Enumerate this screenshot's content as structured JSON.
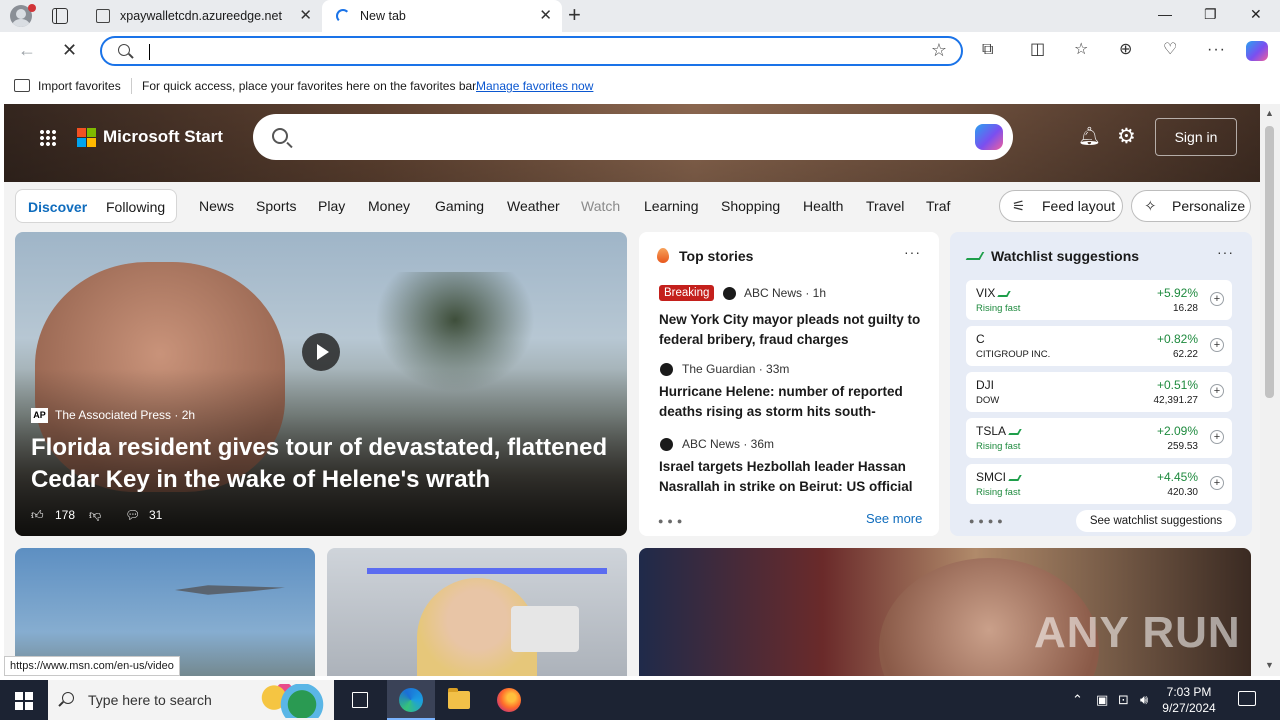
{
  "browser": {
    "tabs": [
      {
        "title": "xpaywalletcdn.azureedge.net"
      },
      {
        "title": "New tab"
      }
    ],
    "address": {
      "value": "",
      "placeholder": ""
    },
    "favorites_bar": {
      "import_label": "Import favorites",
      "hint": "For quick access, place your favorites here on the favorites bar.",
      "manage_link": "Manage favorites now"
    },
    "status_url": "https://www.msn.com/en-us/video",
    "icons": [
      "profile-icon",
      "tab-actions-icon",
      "back-icon",
      "stop-icon",
      "search-icon",
      "favorite-star-icon",
      "extensions-icon",
      "split-screen-icon",
      "favorites-icon",
      "collections-icon",
      "browser-essentials-icon",
      "more-icon",
      "copilot-icon"
    ]
  },
  "header": {
    "brand": "Microsoft Start",
    "sign_in": "Sign in",
    "search_placeholder": ""
  },
  "nav": {
    "feed_tabs": {
      "discover": "Discover",
      "following": "Following"
    },
    "links": [
      "News",
      "Sports",
      "Play",
      "Money",
      "Gaming",
      "Weather",
      "Watch",
      "Learning",
      "Shopping",
      "Health",
      "Travel",
      "Traf"
    ],
    "feed_layout": "Feed layout",
    "personalize": "Personalize"
  },
  "main_story": {
    "source": "The Associated Press",
    "age": "2h",
    "source_logo": "AP",
    "title": "Florida resident gives tour of devastated, flattened Cedar Key in the wake of Helene's wrath",
    "likes": "178",
    "comments": "31"
  },
  "top_stories": {
    "header": "Top stories",
    "see_more": "See more",
    "items": [
      {
        "badge": "Breaking",
        "source": "ABC News · 1h",
        "title": "New York City mayor pleads not guilty to federal bribery, fraud charges"
      },
      {
        "source": "The Guardian · 33m",
        "title": "Hurricane Helene: number of reported deaths rising as storm hits south-easter…"
      },
      {
        "source": "ABC News · 36m",
        "title": "Israel targets Hezbollah leader Hassan Nasrallah in strike on Beirut: US official"
      }
    ]
  },
  "watchlist": {
    "header": "Watchlist suggestions",
    "see_more": "See watchlist suggestions",
    "stocks": [
      {
        "symbol": "VIX",
        "sub": "Rising fast",
        "change": "+5.92%",
        "price": "16.28",
        "rising": true
      },
      {
        "symbol": "C",
        "sub": "CITIGROUP INC.",
        "change": "+0.82%",
        "price": "62.22",
        "rising": false
      },
      {
        "symbol": "DJI",
        "sub": "DOW",
        "change": "+0.51%",
        "price": "42,391.27",
        "rising": false
      },
      {
        "symbol": "TSLA",
        "sub": "Rising fast",
        "change": "+2.09%",
        "price": "259.53",
        "rising": true
      },
      {
        "symbol": "SMCI",
        "sub": "Rising fast",
        "change": "+4.45%",
        "price": "420.30",
        "rising": true
      }
    ]
  },
  "watermark": "ANY RUN",
  "taskbar": {
    "search_placeholder": "Type here to search",
    "time": "7:03 PM",
    "date": "9/27/2024"
  }
}
